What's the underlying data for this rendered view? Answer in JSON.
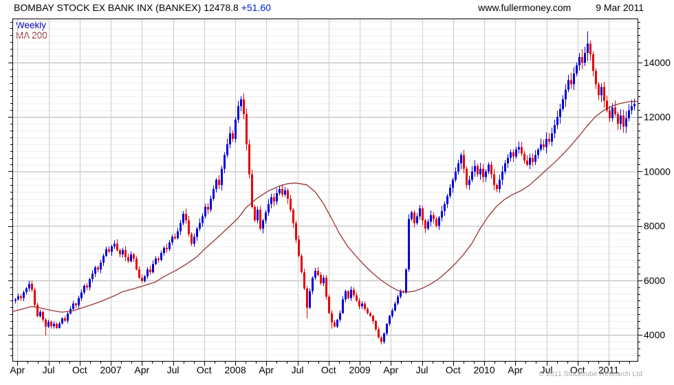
{
  "header": {
    "title": "BOMBAY STOCK EX BANK INX (BANKEX)",
    "last_price": "12478.8",
    "change": "+51.60",
    "website": "www.fullermoney.com",
    "date": "9 Mar 2011"
  },
  "legend": {
    "timeframe": "Weekly",
    "overlay": "MA 200"
  },
  "footer": {
    "copyright": "© 2011 Stockcube Research Ltd"
  },
  "colors": {
    "up": "#0000dd",
    "down": "#e60000",
    "ma": "#993333",
    "grid_minor": "#ededed",
    "grid_major": "#b2b2b2",
    "grid_vertical": "#cccccc",
    "border": "#000000",
    "axis_text": "#000000"
  },
  "chart_data": {
    "type": "candlestick",
    "timeframe": "weekly",
    "title": "BOMBAY STOCK EX BANK INX (BANKEX) 12478.8 +51.60",
    "legend": [
      "Weekly",
      "MA 200"
    ],
    "x_labels": [
      "Apr",
      "Jul",
      "Oct",
      "2007",
      "Apr",
      "Jul",
      "Oct",
      "2008",
      "Apr",
      "Jul",
      "Oct",
      "2009",
      "Apr",
      "Jul",
      "Oct",
      "2010",
      "Apr",
      "Jul",
      "Oct",
      "2011"
    ],
    "y_tick_values": [
      4000,
      6000,
      8000,
      10000,
      12000,
      14000
    ],
    "y_tick_labels": [
      "4000",
      "6000",
      "8000",
      "10000",
      "12000",
      "14000"
    ],
    "y_minor_step": 250,
    "ylim": [
      3015,
      15616
    ],
    "grid": true,
    "legend_position": "top-left",
    "last_price": 12478.8,
    "change": 51.6,
    "closes": [
      5300,
      5420,
      5350,
      5560,
      5700,
      5870,
      5650,
      5100,
      4680,
      4850,
      4550,
      4300,
      4480,
      4320,
      4400,
      4250,
      4420,
      4600,
      4520,
      4780,
      4950,
      5150,
      5080,
      5350,
      5550,
      5800,
      5740,
      6050,
      6250,
      6480,
      6400,
      6650,
      6900,
      7150,
      7050,
      7250,
      7350,
      7100,
      6950,
      7120,
      6850,
      6700,
      6950,
      6800,
      6400,
      6100,
      5980,
      6150,
      6400,
      6300,
      6600,
      6800,
      6750,
      7000,
      7200,
      7150,
      7400,
      7600,
      7550,
      7800,
      8100,
      8450,
      8200,
      7700,
      7350,
      7600,
      7900,
      8100,
      8350,
      8700,
      8600,
      9000,
      9350,
      9700,
      9500,
      10100,
      10600,
      11000,
      11400,
      11200,
      11900,
      12400,
      12650,
      12100,
      11000,
      9900,
      8700,
      8200,
      8600,
      7900,
      8200,
      8500,
      8800,
      9050,
      8900,
      9200,
      9350,
      9150,
      9300,
      9000,
      8600,
      8100,
      7500,
      6900,
      6300,
      5700,
      5000,
      5600,
      6100,
      6350,
      6200,
      5900,
      6100,
      5400,
      4800,
      4450,
      4300,
      4550,
      4800,
      5300,
      5600,
      5350,
      5650,
      5450,
      5250,
      5050,
      5150,
      4950,
      4800,
      4700,
      4500,
      4200,
      3900,
      3750,
      4050,
      4400,
      4700,
      4900,
      5150,
      5400,
      5600,
      5550,
      6400,
      8250,
      8500,
      8100,
      8350,
      8650,
      8200,
      7900,
      8150,
      8400,
      8250,
      8000,
      8300,
      8550,
      8800,
      9100,
      9400,
      9700,
      10000,
      10300,
      10600,
      10100,
      9500,
      9700,
      10000,
      10200,
      9900,
      10100,
      9800,
      10000,
      10250,
      9900,
      9500,
      9350,
      9700,
      10000,
      10300,
      10500,
      10700,
      10550,
      10800,
      10900,
      10650,
      10400,
      10250,
      10500,
      10350,
      10600,
      10800,
      11000,
      10900,
      11200,
      11100,
      11400,
      11700,
      12000,
      12300,
      12650,
      13000,
      13350,
      13200,
      13600,
      13900,
      14200,
      14000,
      14350,
      14700,
      14300,
      13700,
      13200,
      12800,
      13100,
      12600,
      12250,
      11950,
      12350,
      12100,
      11750,
      12050,
      11650,
      11950,
      12250,
      12400,
      12478.8
    ],
    "first_open": 5250,
    "wick_overrides": {
      "11": {
        "lo": 3980
      },
      "82": {
        "hi": 12760
      },
      "106": {
        "lo": 4600
      },
      "115": {
        "lo": 4230
      },
      "133": {
        "lo": 3650
      },
      "208": {
        "hi": 15150
      },
      "221": {
        "lo": 11430
      }
    },
    "ma200": [
      [
        -1,
        4850
      ],
      [
        2,
        4930
      ],
      [
        6,
        5040
      ],
      [
        9,
        4990
      ],
      [
        13,
        4900
      ],
      [
        17,
        4830
      ],
      [
        21,
        4880
      ],
      [
        24,
        4980
      ],
      [
        28,
        5110
      ],
      [
        32,
        5260
      ],
      [
        36,
        5430
      ],
      [
        39,
        5580
      ],
      [
        43,
        5690
      ],
      [
        47,
        5810
      ],
      [
        51,
        5940
      ],
      [
        54,
        6130
      ],
      [
        58,
        6340
      ],
      [
        62,
        6580
      ],
      [
        66,
        6860
      ],
      [
        69,
        7160
      ],
      [
        73,
        7520
      ],
      [
        77,
        7900
      ],
      [
        81,
        8280
      ],
      [
        84,
        8680
      ],
      [
        88,
        9020
      ],
      [
        92,
        9280
      ],
      [
        96,
        9460
      ],
      [
        99,
        9550
      ],
      [
        102,
        9575
      ],
      [
        106,
        9510
      ],
      [
        109,
        9260
      ],
      [
        112,
        8830
      ],
      [
        115,
        8280
      ],
      [
        118,
        7700
      ],
      [
        121,
        7230
      ],
      [
        124,
        6880
      ],
      [
        127,
        6550
      ],
      [
        130,
        6260
      ],
      [
        133,
        6010
      ],
      [
        136,
        5800
      ],
      [
        139,
        5630
      ],
      [
        142,
        5560
      ],
      [
        145,
        5600
      ],
      [
        148,
        5710
      ],
      [
        151,
        5860
      ],
      [
        154,
        6060
      ],
      [
        157,
        6320
      ],
      [
        160,
        6610
      ],
      [
        163,
        6950
      ],
      [
        166,
        7350
      ],
      [
        169,
        7900
      ],
      [
        172,
        8350
      ],
      [
        175,
        8720
      ],
      [
        178,
        8980
      ],
      [
        181,
        9160
      ],
      [
        184,
        9300
      ],
      [
        187,
        9500
      ],
      [
        190,
        9770
      ],
      [
        193,
        10050
      ],
      [
        196,
        10320
      ],
      [
        199,
        10620
      ],
      [
        202,
        10950
      ],
      [
        205,
        11300
      ],
      [
        208,
        11680
      ],
      [
        211,
        12020
      ],
      [
        214,
        12250
      ],
      [
        217,
        12400
      ],
      [
        220,
        12500
      ],
      [
        223,
        12560
      ],
      [
        226.5,
        12580
      ]
    ]
  }
}
